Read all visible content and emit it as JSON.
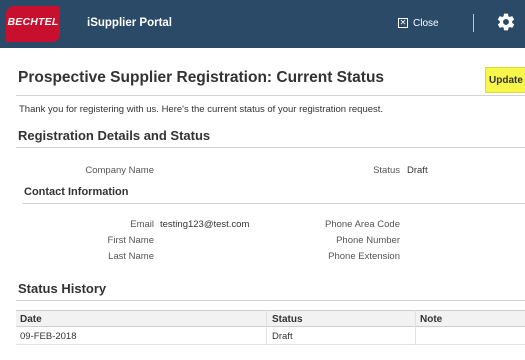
{
  "header": {
    "logo_text": "BECHTEL",
    "app_title": "iSupplier Portal",
    "close_label": "Close",
    "colors": {
      "bar": "#2b4a68",
      "logo": "#c8102e"
    }
  },
  "page": {
    "title": "Prospective Supplier Registration: Current Status",
    "update_label": "Update",
    "intro": "Thank you for registering with us. Here's the current status of your registration request."
  },
  "registration": {
    "heading": "Registration Details and Status",
    "company_name_label": "Company Name",
    "company_name": "",
    "status_label": "Status",
    "status": "Draft"
  },
  "contact": {
    "heading": "Contact Information",
    "email_label": "Email",
    "email": "testing123@test.com",
    "first_name_label": "First Name",
    "first_name": "",
    "last_name_label": "Last Name",
    "last_name": "",
    "phone_area_code_label": "Phone Area Code",
    "phone_area_code": "",
    "phone_number_label": "Phone Number",
    "phone_number": "",
    "phone_extension_label": "Phone Extension",
    "phone_extension": ""
  },
  "status_history": {
    "heading": "Status History",
    "columns": [
      "Date",
      "Status",
      "Note"
    ],
    "rows": [
      {
        "date": "09-FEB-2018",
        "status": "Draft",
        "note": ""
      }
    ]
  },
  "icons": [
    "close-icon",
    "gear-icon"
  ]
}
